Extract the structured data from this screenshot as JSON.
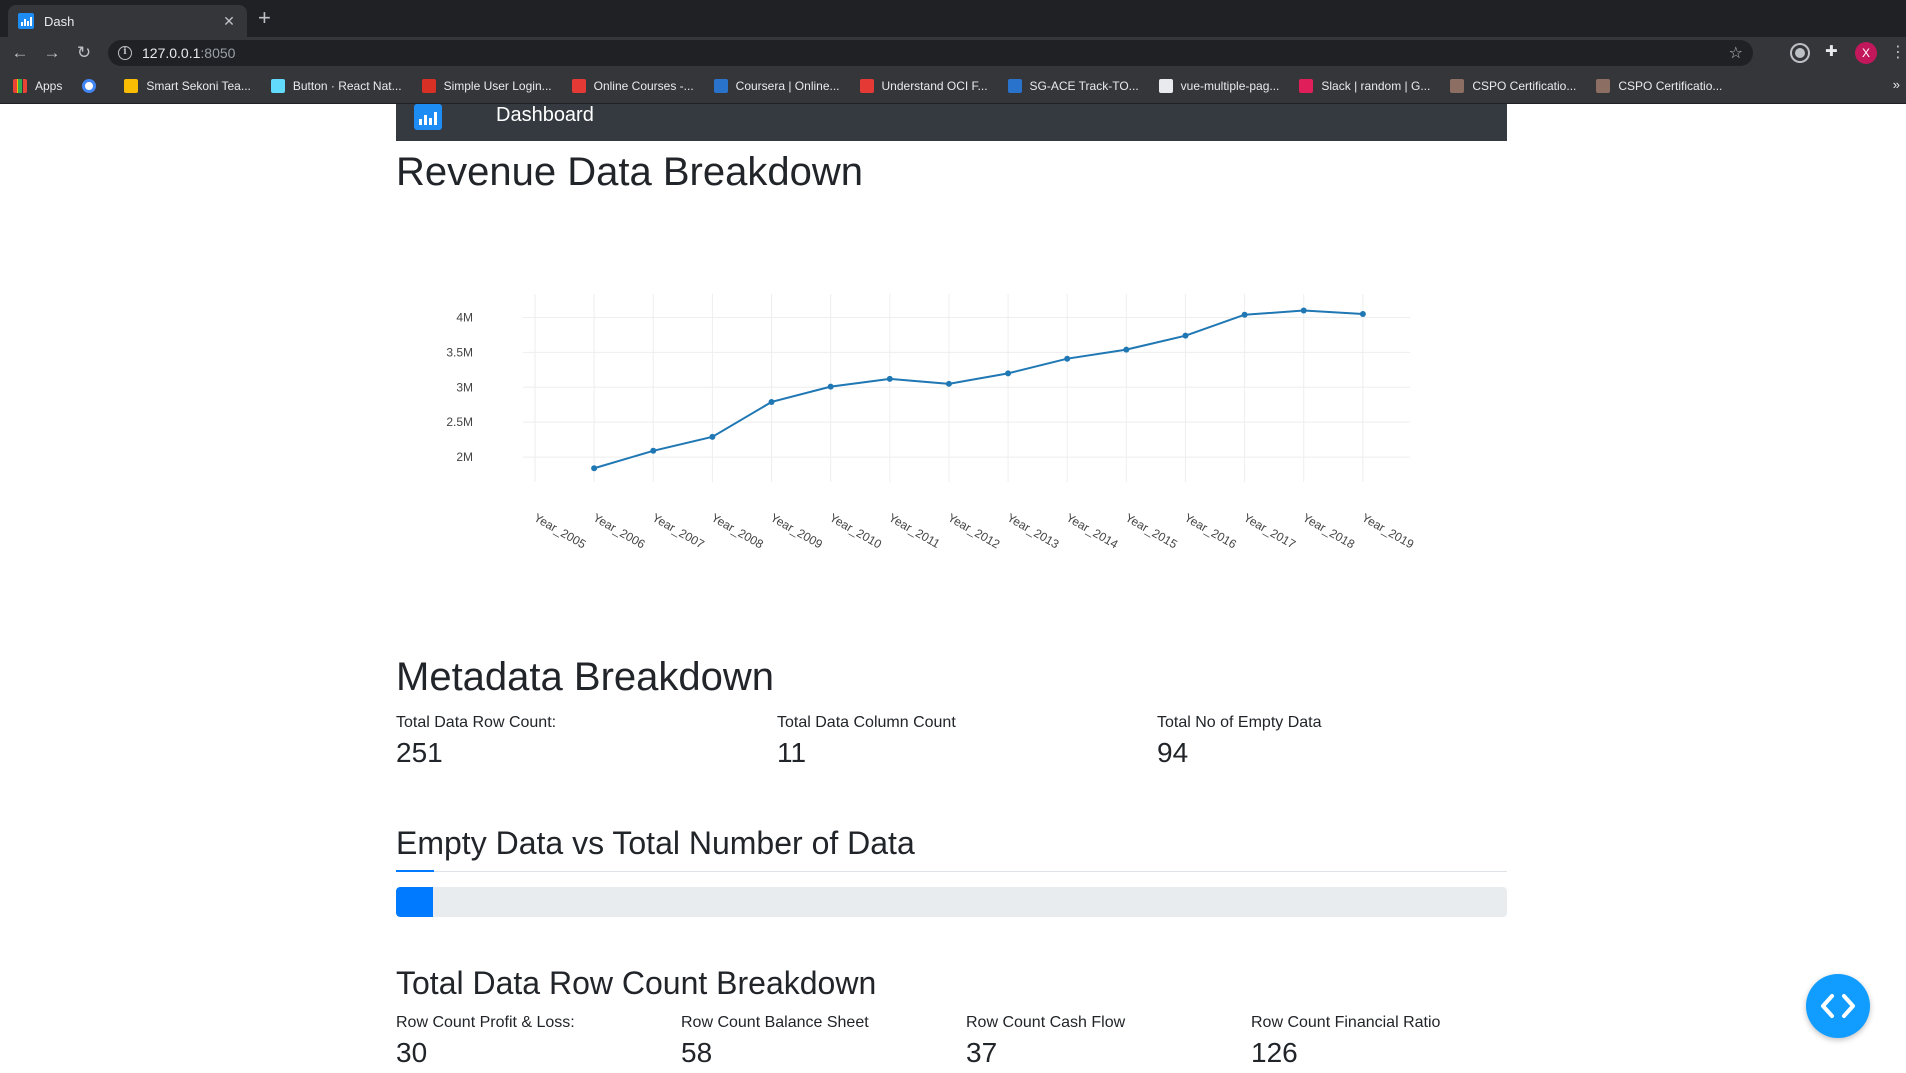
{
  "browser": {
    "tab_title": "Dash",
    "url_host": "127.0.0.1",
    "url_port": ":8050",
    "profile_initial": "X",
    "bookmarks": [
      {
        "label": "Apps",
        "color": "#e8eaed"
      },
      {
        "label": "",
        "color": "#4285f4"
      },
      {
        "label": "Smart Sekoni Tea...",
        "color": "#fbbc04"
      },
      {
        "label": "Button · React Nat...",
        "color": "#61dafb"
      },
      {
        "label": "Simple User Login...",
        "color": "#d93025"
      },
      {
        "label": "Online Courses -...",
        "color": "#e53935"
      },
      {
        "label": "Coursera | Online...",
        "color": "#2a73cc"
      },
      {
        "label": "Understand OCI F...",
        "color": "#e53935"
      },
      {
        "label": "SG-ACE Track-TO...",
        "color": "#2a73cc"
      },
      {
        "label": "vue-multiple-pag...",
        "color": "#e8eaed"
      },
      {
        "label": "Slack | random | G...",
        "color": "#e01e5a"
      },
      {
        "label": "CSPO Certificatio...",
        "color": "#8d6e63"
      },
      {
        "label": "CSPO Certificatio...",
        "color": "#8d6e63"
      }
    ]
  },
  "navbar": {
    "brand": "Dashboard"
  },
  "revenue": {
    "title": "Revenue Data Breakdown"
  },
  "chart_data": {
    "type": "line",
    "title": "",
    "xlabel": "",
    "ylabel": "",
    "categories": [
      "Year_2005",
      "Year_2006",
      "Year_2007",
      "Year_2008",
      "Year_2009",
      "Year_2010",
      "Year_2011",
      "Year_2012",
      "Year_2013",
      "Year_2014",
      "Year_2015",
      "Year_2016",
      "Year_2017",
      "Year_2018",
      "Year_2019"
    ],
    "series": [
      {
        "values": [
          null,
          1840000,
          2090000,
          2290000,
          2790000,
          3010000,
          3120000,
          3050000,
          3200000,
          3410000,
          3540000,
          3740000,
          4040000,
          4100000,
          4050000
        ]
      }
    ],
    "yticks": [
      2000000,
      2500000,
      3000000,
      3500000,
      4000000
    ],
    "ytick_labels": [
      "2M",
      "2.5M",
      "3M",
      "3.5M",
      "4M"
    ],
    "ylim": [
      1700000,
      4280000
    ],
    "grid": true,
    "color": "#1f77b4"
  },
  "metadata": {
    "title": "Metadata Breakdown",
    "stats": [
      {
        "label": "Total Data Row Count:",
        "value": "251"
      },
      {
        "label": "Total Data Column Count",
        "value": "11"
      },
      {
        "label": "Total No of Empty Data",
        "value": "94"
      }
    ]
  },
  "empty_vs_total": {
    "title": "Empty Data vs Total Number of Data",
    "progress_fraction": 0.033
  },
  "row_breakdown": {
    "title": "Total Data Row Count Breakdown",
    "stats": [
      {
        "label": "Row Count Profit & Loss:",
        "value": "30"
      },
      {
        "label": "Row Count Balance Sheet",
        "value": "58"
      },
      {
        "label": "Row Count Cash Flow",
        "value": "37"
      },
      {
        "label": "Row Count Financial Ratio",
        "value": "126"
      }
    ]
  },
  "colors": {
    "accent": "#007bff",
    "navbar": "#343a40",
    "fab": "#119dff"
  }
}
